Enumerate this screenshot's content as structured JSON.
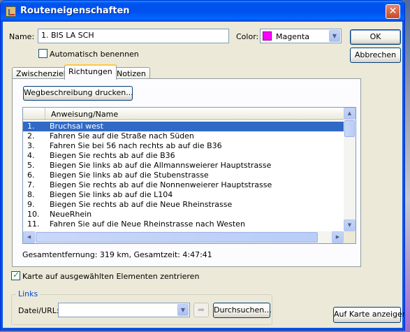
{
  "window": {
    "title": "Routeneigenschaften",
    "close_label": "✕"
  },
  "name_field": {
    "label": "Name:",
    "value": "1. BIS LA SCH"
  },
  "color_field": {
    "label": "Color:",
    "value": "Magenta",
    "swatch": "#ff00ff"
  },
  "auto_name": {
    "label": "Automatisch benennen",
    "checked": false
  },
  "buttons": {
    "ok": "OK",
    "cancel": "Abbrechen",
    "print": "Wegbeschreibung drucken...",
    "browse": "Durchsuchen...",
    "show_on_map": "Auf Karte anzeigen"
  },
  "tabs": [
    {
      "label": "Zwischenziele",
      "active": false
    },
    {
      "label": "Richtungen",
      "active": true
    },
    {
      "label": "Notizen",
      "active": false
    }
  ],
  "directions": {
    "header": "Anweisung/Name",
    "rows": [
      {
        "num": "1.",
        "text": "Bruchsal west",
        "selected": true
      },
      {
        "num": "2.",
        "text": "Fahren Sie auf die Straße nach Süden"
      },
      {
        "num": "3.",
        "text": "Fahren Sie bei 56 nach rechts ab auf die  B36"
      },
      {
        "num": "4.",
        "text": "Biegen Sie rechts ab auf die  B36"
      },
      {
        "num": "5.",
        "text": "Biegen Sie links ab auf die Allmannsweierer Hauptstrasse"
      },
      {
        "num": "6.",
        "text": "Biegen Sie links ab auf die Stubenstrasse"
      },
      {
        "num": "7.",
        "text": "Biegen Sie rechts ab auf die Nonnenweierer Hauptstrasse"
      },
      {
        "num": "8.",
        "text": "Biegen Sie links ab auf die L104"
      },
      {
        "num": "9.",
        "text": "Biegen Sie rechts ab auf die Neue Rheinstrasse"
      },
      {
        "num": "10.",
        "text": "NeueRhein"
      },
      {
        "num": "11.",
        "text": "Fahren Sie auf die Neue Rheinstrasse nach Westen"
      }
    ]
  },
  "summary": "Gesamtentfernung: 319 km, Gesamtzeit: 4:47:41",
  "center_map": {
    "label": "Karte auf ausgewählten Elementen zentrieren",
    "checked": true
  },
  "links": {
    "legend": "Links",
    "url_label": "Datei/URL:",
    "url_value": ""
  }
}
